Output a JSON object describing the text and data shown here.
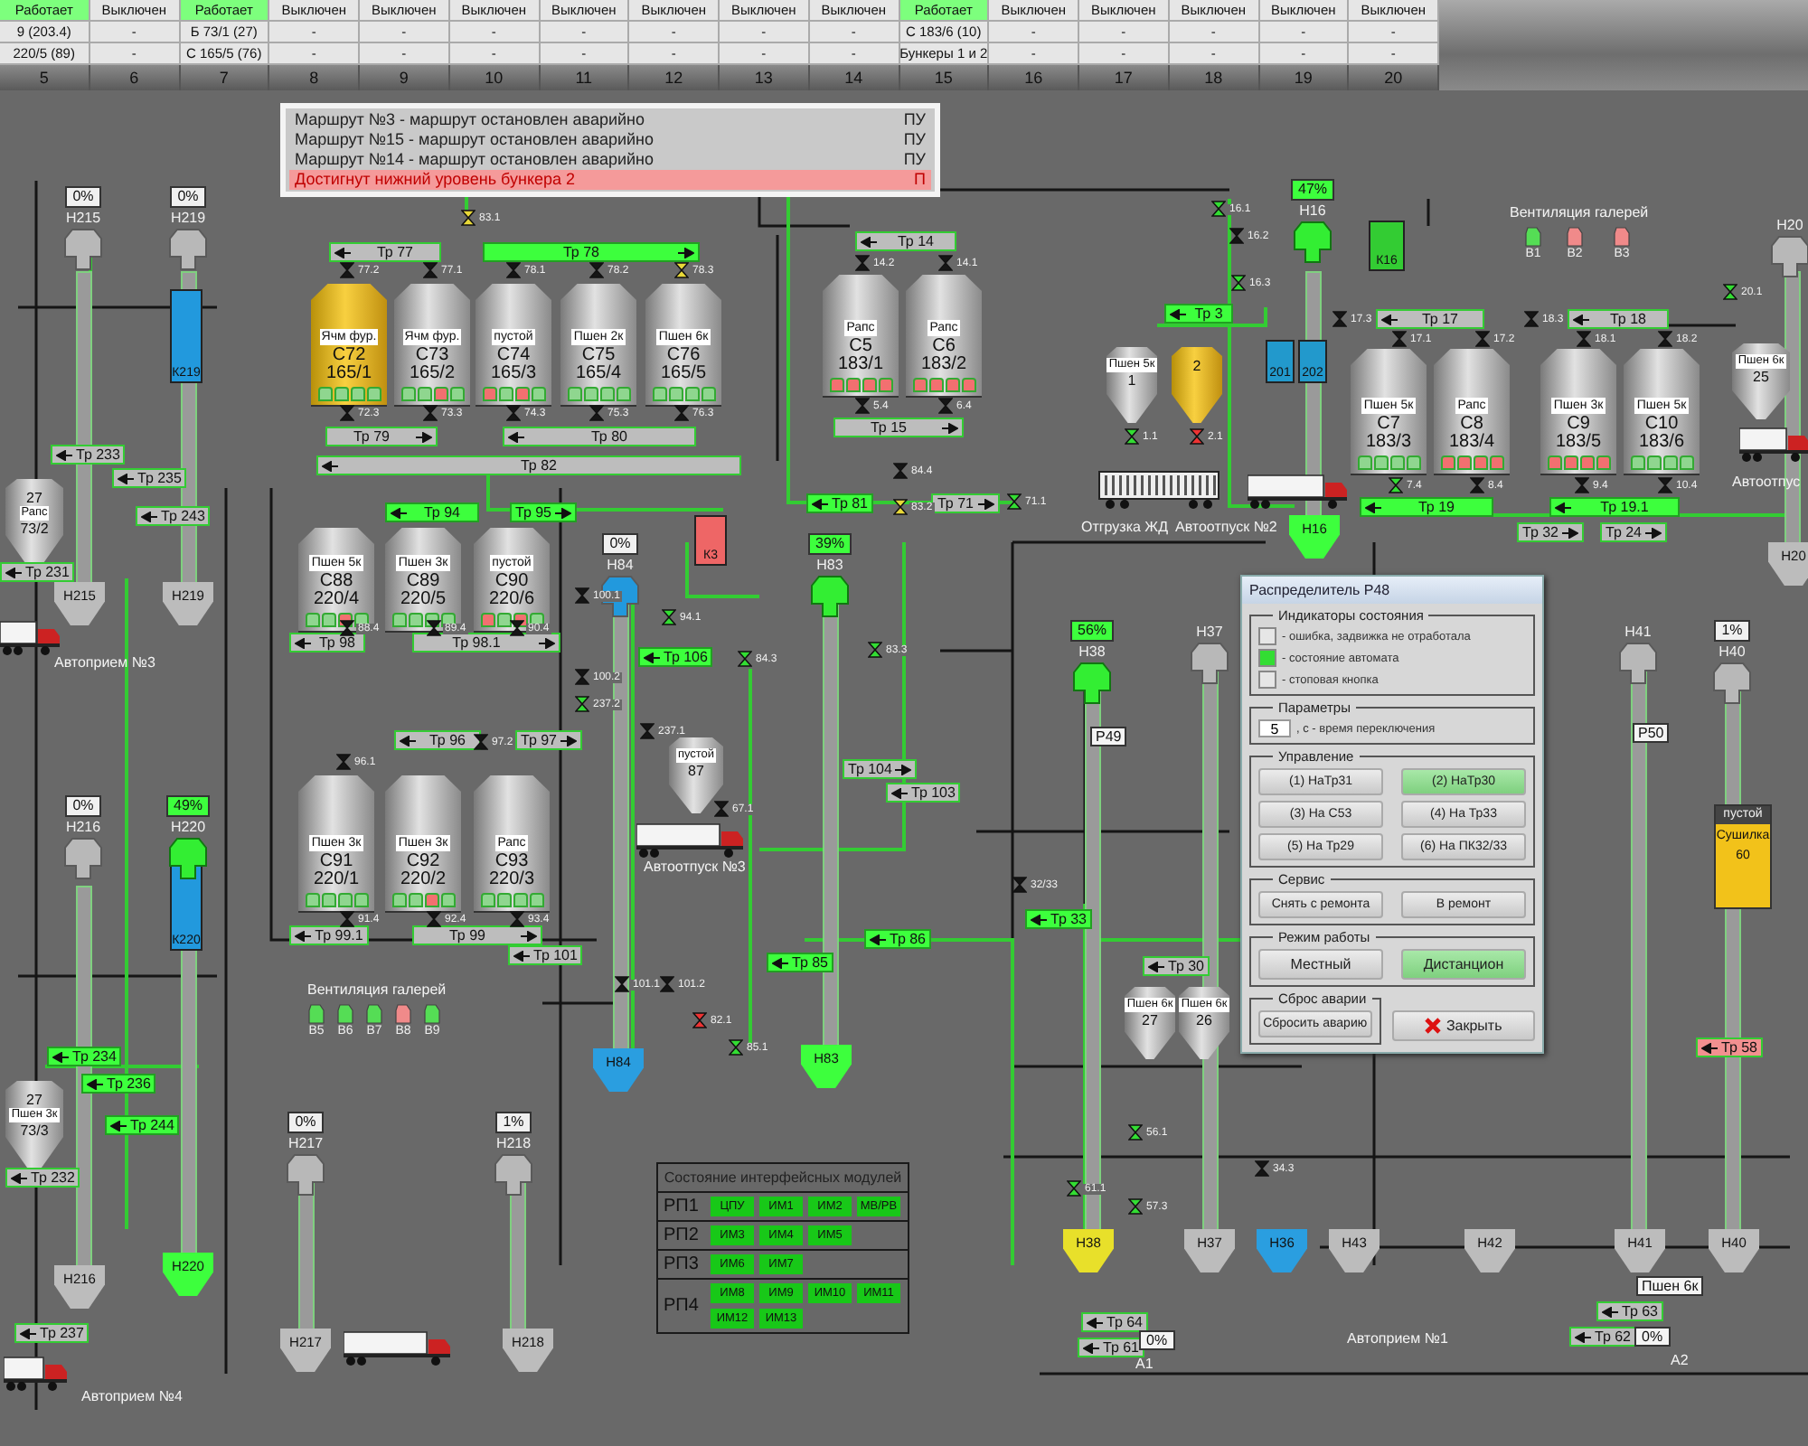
{
  "status_table": {
    "columns": [
      {
        "number": "5",
        "state": "Работает",
        "running": true,
        "route": "9 (203.4)",
        "source": "220/5 (89)"
      },
      {
        "number": "6",
        "state": "Выключен",
        "running": false,
        "route": "-",
        "source": "-"
      },
      {
        "number": "7",
        "state": "Работает",
        "running": true,
        "route": "Б 73/1 (27)",
        "source": "С 165/5 (76)"
      },
      {
        "number": "8",
        "state": "Выключен",
        "running": false,
        "route": "-",
        "source": "-"
      },
      {
        "number": "9",
        "state": "Выключен",
        "running": false,
        "route": "-",
        "source": "-"
      },
      {
        "number": "10",
        "state": "Выключен",
        "running": false,
        "route": "-",
        "source": "-"
      },
      {
        "number": "11",
        "state": "Выключен",
        "running": false,
        "route": "-",
        "source": "-"
      },
      {
        "number": "12",
        "state": "Выключен",
        "running": false,
        "route": "-",
        "source": "-"
      },
      {
        "number": "13",
        "state": "Выключен",
        "running": false,
        "route": "-",
        "source": "-"
      },
      {
        "number": "14",
        "state": "Выключен",
        "running": false,
        "route": "-",
        "source": "-"
      },
      {
        "number": "15",
        "state": "Работает",
        "running": true,
        "route": "С 183/6 (10)",
        "source": "Бункеры 1 и 2"
      },
      {
        "number": "16",
        "state": "Выключен",
        "running": false,
        "route": "-",
        "source": "-"
      },
      {
        "number": "17",
        "state": "Выключен",
        "running": false,
        "route": "-",
        "source": "-"
      },
      {
        "number": "18",
        "state": "Выключен",
        "running": false,
        "route": "-",
        "source": "-"
      },
      {
        "number": "19",
        "state": "Выключен",
        "running": false,
        "route": "-",
        "source": "-"
      },
      {
        "number": "20",
        "state": "Выключен",
        "running": false,
        "route": "-",
        "source": "-"
      }
    ]
  },
  "alarms": [
    {
      "text": "Маршрут №3 - маршрут остановлен аварийно",
      "source": "ПУ",
      "kind": "event"
    },
    {
      "text": "Маршрут №15 - маршрут остановлен аварийно",
      "source": "ПУ",
      "kind": "event"
    },
    {
      "text": "Маршрут №14 - маршрут остановлен аварийно",
      "source": "ПУ",
      "kind": "event"
    },
    {
      "text": "Достигнут нижний уровень бункера 2",
      "source": "П",
      "kind": "alarm"
    }
  ],
  "silos": [
    {
      "product": "Ячм фур.",
      "name": "С72",
      "capacity": "165/1",
      "filled": true,
      "sensor_alarms": [
        false,
        false,
        false,
        false
      ]
    },
    {
      "product": "Ячм фур.",
      "name": "С73",
      "capacity": "165/2",
      "filled": false,
      "sensor_alarms": [
        false,
        false,
        true,
        false
      ]
    },
    {
      "product": "пустой",
      "name": "С74",
      "capacity": "165/3",
      "filled": false,
      "sensor_alarms": [
        true,
        false,
        true,
        false
      ]
    },
    {
      "product": "Пшен 2к",
      "name": "С75",
      "capacity": "165/4",
      "filled": false,
      "sensor_alarms": [
        false,
        false,
        false,
        false
      ]
    },
    {
      "product": "Пшен 6к",
      "name": "С76",
      "capacity": "165/5",
      "filled": false,
      "sensor_alarms": [
        false,
        false,
        false,
        false
      ]
    },
    {
      "product": "Рапс",
      "name": "С5",
      "capacity": "183/1",
      "filled": false,
      "sensor_alarms": [
        true,
        true,
        true,
        true
      ]
    },
    {
      "product": "Рапс",
      "name": "С6",
      "capacity": "183/2",
      "filled": false,
      "sensor_alarms": [
        true,
        true,
        true,
        true
      ]
    },
    {
      "product": "Пшен 5к",
      "name": "С7",
      "capacity": "183/3",
      "filled": false,
      "sensor_alarms": [
        false,
        false,
        false,
        false
      ]
    },
    {
      "product": "Рапс",
      "name": "С8",
      "capacity": "183/4",
      "filled": false,
      "sensor_alarms": [
        true,
        true,
        true,
        true
      ]
    },
    {
      "product": "Пшен 3к",
      "name": "С9",
      "capacity": "183/5",
      "filled": false,
      "sensor_alarms": [
        true,
        true,
        true,
        true
      ]
    },
    {
      "product": "Пшен 5к",
      "name": "С10",
      "capacity": "183/6",
      "filled": false,
      "sensor_alarms": [
        false,
        false,
        false,
        false
      ]
    },
    {
      "product": "Пшен 5к",
      "name": "С88",
      "capacity": "220/4",
      "filled": false,
      "sensor_alarms": [
        false,
        false,
        true,
        false
      ]
    },
    {
      "product": "Пшен 3к",
      "name": "С89",
      "capacity": "220/5",
      "filled": false,
      "sensor_alarms": [
        false,
        false,
        false,
        false
      ]
    },
    {
      "product": "пустой",
      "name": "С90",
      "capacity": "220/6",
      "filled": false,
      "sensor_alarms": [
        true,
        false,
        true,
        false
      ]
    },
    {
      "product": "Пшен 3к",
      "name": "С91",
      "capacity": "220/1",
      "filled": false,
      "sensor_alarms": [
        false,
        false,
        false,
        false
      ]
    },
    {
      "product": "Пшен 3к",
      "name": "С92",
      "capacity": "220/2",
      "filled": false,
      "sensor_alarms": [
        false,
        false,
        true,
        false
      ]
    },
    {
      "product": "Рапс",
      "name": "С93",
      "capacity": "220/3",
      "filled": false,
      "sensor_alarms": [
        false,
        false,
        false,
        false
      ]
    }
  ],
  "bins": [
    {
      "product": "Пшен 5к",
      "number": "1",
      "filled": false
    },
    {
      "number": "2",
      "filled": true
    },
    {
      "product": "Пшен 6к",
      "number": "25",
      "filled": false
    },
    {
      "product": "пустой",
      "number": "87",
      "filled": false
    },
    {
      "product": "Рапс",
      "number": "27",
      "code": "73/2",
      "filled": false
    },
    {
      "product": "Пшен 3к",
      "number": "27",
      "code": "73/3",
      "filled": false
    },
    {
      "product": "Пшен 6к",
      "number": "27",
      "filled": false
    },
    {
      "product": "Пшен 6к",
      "number": "26",
      "filled": false
    }
  ],
  "conveyors": [
    {
      "label": "Тр 77",
      "running": false,
      "alarm": false,
      "arrow_right": false
    },
    {
      "label": "Тр 78",
      "running": true,
      "alarm": false,
      "arrow_right": true
    },
    {
      "label": "Тр 79",
      "running": false,
      "alarm": false,
      "arrow_right": true
    },
    {
      "label": "Тр 80",
      "running": false,
      "alarm": false,
      "arrow_right": false
    },
    {
      "label": "Тр 82",
      "running": false,
      "alarm": false,
      "arrow_right": false
    },
    {
      "label": "Тр 14",
      "running": false,
      "alarm": false,
      "arrow_right": false
    },
    {
      "label": "Тр 15",
      "running": false,
      "alarm": false,
      "arrow_right": true
    },
    {
      "label": "Тр 3",
      "running": true,
      "alarm": false,
      "arrow_right": false
    },
    {
      "label": "Тр 17",
      "running": false,
      "alarm": false,
      "arrow_right": false
    },
    {
      "label": "Тр 18",
      "running": false,
      "alarm": false,
      "arrow_right": false
    },
    {
      "label": "Тр 19",
      "running": true,
      "alarm": false,
      "arrow_right": false
    },
    {
      "label": "Тр 19.1",
      "running": true,
      "alarm": false,
      "arrow_right": false
    },
    {
      "label": "Тр 32",
      "running": false,
      "alarm": false,
      "arrow_right": true
    },
    {
      "label": "Тр 24",
      "running": false,
      "alarm": false,
      "arrow_right": true
    },
    {
      "label": "Тр 81",
      "running": true,
      "alarm": false,
      "arrow_right": false
    },
    {
      "label": "Тр 71",
      "running": false,
      "alarm": false,
      "arrow_right": true
    },
    {
      "label": "Тр 94",
      "running": true,
      "alarm": false,
      "arrow_right": false
    },
    {
      "label": "Тр 95",
      "running": true,
      "alarm": false,
      "arrow_right": true
    },
    {
      "label": "Тр 98",
      "running": false,
      "alarm": false,
      "arrow_right": false
    },
    {
      "label": "Тр 98.1",
      "running": false,
      "alarm": false,
      "arrow_right": true
    },
    {
      "label": "Тр 96",
      "running": false,
      "alarm": false,
      "arrow_right": false
    },
    {
      "label": "Тр 97",
      "running": false,
      "alarm": false,
      "arrow_right": true
    },
    {
      "label": "Тр 99.1",
      "running": false,
      "alarm": false,
      "arrow_right": false
    },
    {
      "label": "Тр 99",
      "running": false,
      "alarm": false,
      "arrow_right": true
    },
    {
      "label": "Тр 101",
      "running": false,
      "alarm": false,
      "arrow_right": false
    },
    {
      "label": "Тр 106",
      "running": true,
      "alarm": false,
      "arrow_right": false
    },
    {
      "label": "Тр 104",
      "running": false,
      "alarm": false,
      "arrow_right": true
    },
    {
      "label": "Тр 103",
      "running": false,
      "alarm": false,
      "arrow_right": false
    },
    {
      "label": "Тр 85",
      "running": true,
      "alarm": false,
      "arrow_right": false
    },
    {
      "label": "Тр 86",
      "running": true,
      "alarm": false,
      "arrow_right": false
    },
    {
      "label": "Тр 33",
      "running": true,
      "alarm": false,
      "arrow_right": false
    },
    {
      "label": "Тр 233",
      "running": false,
      "alarm": false,
      "arrow_right": false
    },
    {
      "label": "Тр 235",
      "running": false,
      "alarm": false,
      "arrow_right": false
    },
    {
      "label": "Тр 243",
      "running": false,
      "alarm": false,
      "arrow_right": false
    },
    {
      "label": "Тр 231",
      "running": false,
      "alarm": false,
      "arrow_right": false
    },
    {
      "label": "Тр 234",
      "running": true,
      "alarm": false,
      "arrow_right": false
    },
    {
      "label": "Тр 236",
      "running": true,
      "alarm": false,
      "arrow_right": false
    },
    {
      "label": "Тр 244",
      "running": true,
      "alarm": false,
      "arrow_right": false
    },
    {
      "label": "Тр 232",
      "running": false,
      "alarm": false,
      "arrow_right": false
    },
    {
      "label": "Тр 237",
      "running": false,
      "alarm": false,
      "arrow_right": false
    },
    {
      "label": "Тр 30",
      "running": false,
      "alarm": false,
      "arrow_right": false
    },
    {
      "label": "Тр 58",
      "running": false,
      "alarm": true,
      "arrow_right": false
    },
    {
      "label": "Тр 64",
      "running": false,
      "alarm": false,
      "arrow_right": false
    },
    {
      "label": "Тр 61",
      "running": false,
      "alarm": false,
      "arrow_right": false
    },
    {
      "label": "Тр 63",
      "running": false,
      "alarm": false,
      "arrow_right": false
    },
    {
      "label": "Тр 62",
      "running": false,
      "alarm": false,
      "arrow_right": false
    }
  ],
  "valves": [
    {
      "label": "77.2",
      "color": "#151515"
    },
    {
      "label": "77.1",
      "color": "#151515"
    },
    {
      "label": "78.1",
      "color": "#151515"
    },
    {
      "label": "78.2",
      "color": "#151515"
    },
    {
      "label": "78.3",
      "color": "#e8d838"
    },
    {
      "label": "72.3",
      "color": "#151515"
    },
    {
      "label": "73.3",
      "color": "#151515"
    },
    {
      "label": "74.3",
      "color": "#151515"
    },
    {
      "label": "75.3",
      "color": "#151515"
    },
    {
      "label": "76.3",
      "color": "#151515"
    },
    {
      "label": "83.1",
      "color": "#e8d838"
    },
    {
      "label": "14.2",
      "color": "#151515"
    },
    {
      "label": "14.1",
      "color": "#151515"
    },
    {
      "label": "5.4",
      "color": "#151515"
    },
    {
      "label": "6.4",
      "color": "#151515"
    },
    {
      "label": "16.1",
      "color": "#33dd33"
    },
    {
      "label": "16.2",
      "color": "#151515"
    },
    {
      "label": "16.3",
      "color": "#33dd33"
    },
    {
      "label": "1.1",
      "color": "#33dd33"
    },
    {
      "label": "2.1",
      "color": "#ee3333"
    },
    {
      "label": "17.3",
      "color": "#151515"
    },
    {
      "label": "17.1",
      "color": "#151515"
    },
    {
      "label": "17.2",
      "color": "#151515"
    },
    {
      "label": "18.3",
      "color": "#151515"
    },
    {
      "label": "18.1",
      "color": "#151515"
    },
    {
      "label": "18.2",
      "color": "#151515"
    },
    {
      "label": "7.4",
      "color": "#33dd33"
    },
    {
      "label": "8.4",
      "color": "#151515"
    },
    {
      "label": "9.4",
      "color": "#151515"
    },
    {
      "label": "10.4",
      "color": "#151515"
    },
    {
      "label": "20.1",
      "color": "#33dd33"
    },
    {
      "label": "71.1",
      "color": "#33dd33"
    },
    {
      "label": "84.4",
      "color": "#151515"
    },
    {
      "label": "83.2",
      "color": "#e8d838"
    },
    {
      "label": "88.4",
      "color": "#151515"
    },
    {
      "label": "89.4",
      "color": "#151515"
    },
    {
      "label": "90.4",
      "color": "#151515"
    },
    {
      "label": "96.1",
      "color": "#151515"
    },
    {
      "label": "97.2",
      "color": "#151515"
    },
    {
      "label": "91.4",
      "color": "#151515"
    },
    {
      "label": "92.4",
      "color": "#151515"
    },
    {
      "label": "93.4",
      "color": "#151515"
    },
    {
      "label": "94.1",
      "color": "#33dd33"
    },
    {
      "label": "84.3",
      "color": "#33dd33"
    },
    {
      "label": "83.3",
      "color": "#33dd33"
    },
    {
      "label": "100.1",
      "color": "#151515"
    },
    {
      "label": "100.2",
      "color": "#151515"
    },
    {
      "label": "237.2",
      "color": "#33dd33"
    },
    {
      "label": "237.1",
      "color": "#151515"
    },
    {
      "label": "67.1",
      "color": "#151515"
    },
    {
      "label": "101.1",
      "color": "#151515"
    },
    {
      "label": "101.2",
      "color": "#151515"
    },
    {
      "label": "82.1",
      "color": "#ee3333"
    },
    {
      "label": "85.1",
      "color": "#33dd33"
    },
    {
      "label": "32/33",
      "color": "#151515"
    },
    {
      "label": "56.1",
      "color": "#33dd33"
    },
    {
      "label": "34.3",
      "color": "#151515"
    },
    {
      "label": "61.1",
      "color": "#33dd33"
    },
    {
      "label": "57.3",
      "color": "#33dd33"
    }
  ],
  "bunkers": [
    {
      "name": "Н215",
      "level_text": "0%",
      "active": false
    },
    {
      "name": "Н219",
      "level_text": "0%",
      "active": false
    },
    {
      "name": "Н16",
      "level_text": "47%",
      "active": true
    },
    {
      "name": "Н84",
      "level_text": "0%",
      "active": false,
      "kind": "blue"
    },
    {
      "name": "Н83",
      "level_text": "39%",
      "active": true
    },
    {
      "name": "Н38",
      "level_text": "56%",
      "active": true
    },
    {
      "name": "Н37",
      "active": false
    },
    {
      "name": "Н41",
      "active": false
    },
    {
      "name": "Н40",
      "level_text": "1%",
      "active": false
    },
    {
      "name": "Н20",
      "active": false
    },
    {
      "name": "Н216",
      "level_text": "0%",
      "active": false
    },
    {
      "name": "Н220",
      "level_text": "49%",
      "active": true
    },
    {
      "name": "Н217",
      "level_text": "0%",
      "active": false
    },
    {
      "name": "Н218",
      "level_text": "1%",
      "active": false
    }
  ],
  "hoppers": [
    {
      "name": "Н215",
      "color": "#bcbcbc"
    },
    {
      "name": "Н219",
      "color": "#bcbcbc"
    },
    {
      "name": "Н216",
      "color": "#bcbcbc"
    },
    {
      "name": "Н220",
      "color": "#3dff3d"
    },
    {
      "name": "Н217",
      "color": "#bcbcbc"
    },
    {
      "name": "Н218",
      "color": "#bcbcbc"
    },
    {
      "name": "Н84",
      "color": "#2a9ee0"
    },
    {
      "name": "Н83",
      "color": "#3dff3d"
    },
    {
      "name": "Н16",
      "color": "#3dff3d"
    },
    {
      "name": "Н38",
      "color": "#e8e02a"
    },
    {
      "name": "Н37",
      "color": "#bcbcbc"
    },
    {
      "name": "Н36",
      "color": "#2a9ee0"
    },
    {
      "name": "Н43",
      "color": "#bcbcbc"
    },
    {
      "name": "Н42",
      "color": "#bcbcbc"
    },
    {
      "name": "Н41",
      "color": "#bcbcbc"
    },
    {
      "name": "Н40",
      "color": "#bcbcbc"
    },
    {
      "name": "Н20",
      "color": "#bcbcbc"
    }
  ],
  "panels": [
    {
      "label": "К16",
      "color": "#33cc33"
    },
    {
      "label": "К219",
      "color": "#2299dd"
    },
    {
      "label": "К220",
      "color": "#2299dd"
    },
    {
      "label": "К3",
      "color": "#ee6666"
    },
    {
      "label": "201",
      "color": "#2299cc"
    },
    {
      "label": "202",
      "color": "#2299cc"
    }
  ],
  "dryer": {
    "product": "пустой",
    "name": "Сушилка",
    "number": "60"
  },
  "fans": [
    {
      "label": "В1",
      "running": true
    },
    {
      "label": "В2",
      "running": false
    },
    {
      "label": "В3",
      "running": false
    },
    {
      "label": "В5",
      "running": true
    },
    {
      "label": "В6",
      "running": true
    },
    {
      "label": "В7",
      "running": true
    },
    {
      "label": "В8",
      "running": false
    },
    {
      "label": "В9",
      "running": true
    }
  ],
  "captions": [
    {
      "text": "Автоприем №3",
      "kind": "text"
    },
    {
      "text": "Автоприем №4",
      "kind": "text"
    },
    {
      "text": "Автоприем №1",
      "kind": "text"
    },
    {
      "text": "Автоотпуск №3",
      "kind": "text"
    },
    {
      "text": "Отгрузка ЖД",
      "kind": "text"
    },
    {
      "text": "Автоотпуск №2",
      "kind": "text"
    },
    {
      "text": "Автоотпус",
      "kind": "text"
    },
    {
      "text": "Вентиляция галерей",
      "kind": "text"
    },
    {
      "text": "Вентиляция галерей",
      "kind": "text"
    },
    {
      "text": "Р49",
      "kind": "tag"
    },
    {
      "text": "Р50",
      "kind": "tag"
    },
    {
      "text": "Пшен 6к",
      "kind": "tag"
    },
    {
      "text": "0%",
      "kind": "readout"
    },
    {
      "text": "0%",
      "kind": "readout"
    },
    {
      "text": "А1",
      "kind": "text"
    },
    {
      "text": "А2",
      "kind": "text"
    }
  ],
  "modules": {
    "title": "Состояние интерфейсных модулей",
    "rows": [
      {
        "name": "РП1",
        "modules": [
          {
            "label": "ЦПУ",
            "ok": true
          },
          {
            "label": "ИМ1",
            "ok": true
          },
          {
            "label": "ИМ2",
            "ok": true
          },
          {
            "label": "МВ/РВ",
            "ok": true
          }
        ]
      },
      {
        "name": "РП2",
        "modules": [
          {
            "label": "ИМ3",
            "ok": true
          },
          {
            "label": "ИМ4",
            "ok": true
          },
          {
            "label": "ИМ5",
            "ok": true
          }
        ]
      },
      {
        "name": "РП3",
        "modules": [
          {
            "label": "ИМ6",
            "ok": true
          },
          {
            "label": "ИМ7",
            "ok": true
          }
        ]
      },
      {
        "name": "РП4",
        "modules": [
          {
            "label": "ИМ8",
            "ok": true
          },
          {
            "label": "ИМ9",
            "ok": true
          },
          {
            "label": "ИМ10",
            "ok": true
          },
          {
            "label": "ИМ11",
            "ok": true
          },
          {
            "label": "ИМ12",
            "ok": true
          },
          {
            "label": "ИМ13",
            "ok": true
          }
        ]
      }
    ]
  },
  "dialog": {
    "title": "Распределитель Р48",
    "indicators": {
      "title": "Индикаторы состояния",
      "items": [
        {
          "label": "- ошибка, задвижка не отработала",
          "on": false
        },
        {
          "label": "- состояние автомата",
          "on": true
        },
        {
          "label": "- стоповая кнопка",
          "on": false
        }
      ]
    },
    "parameters": {
      "title": "Параметры",
      "value": "5",
      "label": ", с - время переключения"
    },
    "control": {
      "title": "Управление",
      "buttons": [
        {
          "label": "(1) НаТр31",
          "selected": false
        },
        {
          "label": "(2) НаТр30",
          "selected": true
        },
        {
          "label": "(3) На С53",
          "selected": false
        },
        {
          "label": "(4) На Тр33",
          "selected": false
        },
        {
          "label": "(5) На Тр29",
          "selected": false
        },
        {
          "label": "(6) На ПК32/33",
          "selected": false
        }
      ]
    },
    "service": {
      "title": "Сервис",
      "buttons": [
        {
          "label": "Снять с ремонта"
        },
        {
          "label": "В ремонт"
        }
      ]
    },
    "mode": {
      "title": "Режим работы",
      "buttons": [
        {
          "label": "Местный",
          "selected": false
        },
        {
          "label": "Дистанцион",
          "selected": true
        }
      ]
    },
    "reset": {
      "title": "Сброс аварии",
      "button": "Сбросить аварию"
    },
    "close_button": "Закрыть"
  }
}
